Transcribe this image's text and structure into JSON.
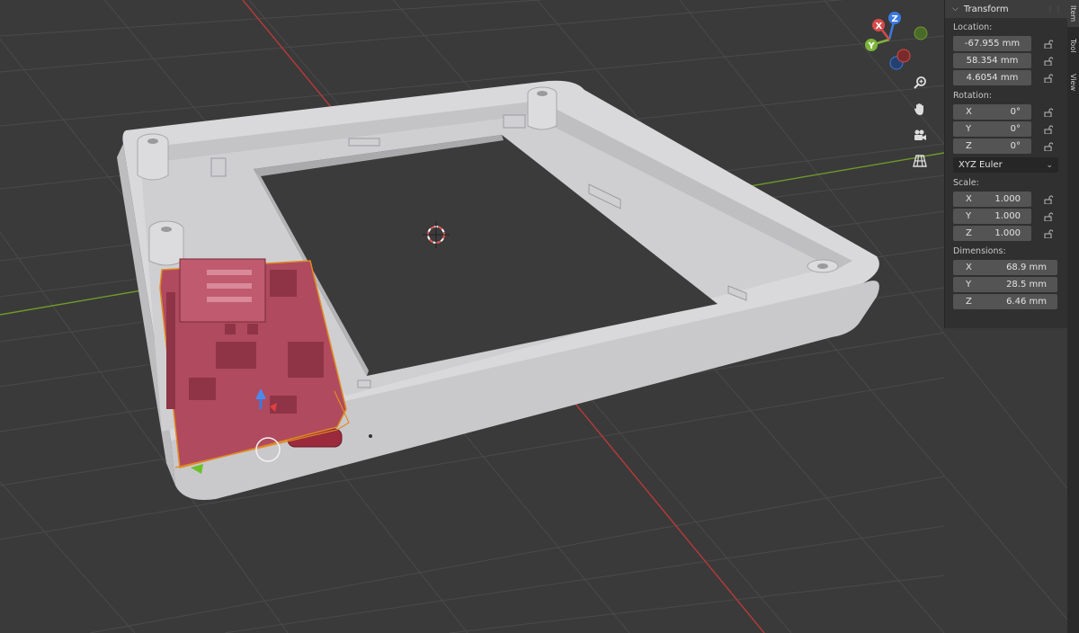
{
  "gizmo": {
    "x": "X",
    "y": "Y",
    "z": "Z"
  },
  "tools": [
    {
      "name": "zoom-tool-button",
      "icon": "zoom-icon",
      "glyph": "🔍"
    },
    {
      "name": "pan-tool-button",
      "icon": "hand-icon",
      "glyph": "✋"
    },
    {
      "name": "camera-view-button",
      "icon": "camera-icon",
      "glyph": "🎥"
    },
    {
      "name": "perspective-toggle-button",
      "icon": "grid-icon",
      "glyph": "▦"
    }
  ],
  "panel": {
    "title": "Transform",
    "location": {
      "label": "Location:",
      "x": "-67.955 mm",
      "y": "58.354 mm",
      "z": "4.6054 mm"
    },
    "rotation": {
      "label": "Rotation:",
      "x_label": "X",
      "x": "0°",
      "y_label": "Y",
      "y": "0°",
      "z_label": "Z",
      "z": "0°",
      "mode": "XYZ Euler"
    },
    "scale": {
      "label": "Scale:",
      "x_label": "X",
      "x": "1.000",
      "y_label": "Y",
      "y": "1.000",
      "z_label": "Z",
      "z": "1.000"
    },
    "dimensions": {
      "label": "Dimensions:",
      "x_label": "X",
      "x": "68.9 mm",
      "y_label": "Y",
      "y": "28.5 mm",
      "z_label": "Z",
      "z": "6.46 mm"
    }
  },
  "tabs": [
    "Item",
    "Tool",
    "View"
  ],
  "colors": {
    "background": "#3a3a3a",
    "x_axis": "#b83a3a",
    "y_axis": "#6f9a2a",
    "selection": "#e08a22",
    "board": "#b04a5e"
  }
}
